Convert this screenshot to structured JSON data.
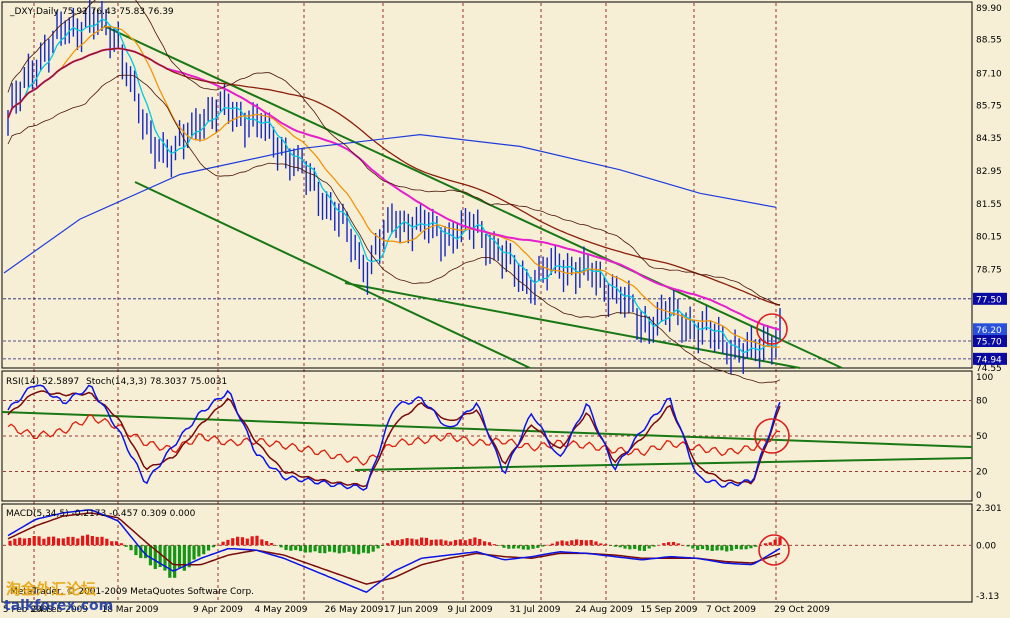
{
  "header": {
    "symbol": "_DXY,Daily",
    "ohlc": "75.92 76.43 75.83 76.39",
    "rsi_label": "RSI(14) 52.5897",
    "stoch_label": "Stoch(14,3,3) 78.3037 75.0031",
    "macd_label": "MACD(5,34,5) -0.2173 -0.457 0.309 0.000",
    "copyright": "MetaTrader, © 2001-2009 MetaQuotes Software Corp."
  },
  "watermark": {
    "chinese": "淘金外汇论坛",
    "site": "talkforex.com"
  },
  "colors": {
    "background": "#f6efd6",
    "price_bars": "#1428c8",
    "ma_fast": "#00c8e6",
    "ma_orange": "#f0960a",
    "ma_magenta": "#e61ecd",
    "ma_brown": "#8c1e0a",
    "ma_blue_long": "#1e3cdc",
    "bollinger": "#4a1406",
    "channel": "#197814",
    "rsi": "#dc1e0a",
    "stoch_main": "#0a14e6",
    "stoch_signal": "#7a0a0a",
    "macd_pos": "#e61414",
    "macd_neg": "#149614",
    "circle": "#dc1e1e",
    "price_tag_bg": "#0a0aa0",
    "grid": "#7a0000"
  },
  "chart_data": [
    {
      "type": "candlestick",
      "title": "_DXY,Daily",
      "ylim": [
        74.55,
        89.9
      ],
      "y_ticks": [
        89.9,
        88.55,
        87.1,
        85.75,
        84.35,
        82.95,
        81.55,
        80.15,
        78.75,
        77.5,
        76.2,
        75.7,
        74.94,
        74.55
      ],
      "y_tick_labels": [
        "89.90",
        "88.55",
        "87.10",
        "85.75",
        "84.35",
        "82.95",
        "81.55",
        "80.15",
        "78.75",
        "77.50",
        "76.20",
        "75.70",
        "74.94",
        "74.55"
      ],
      "x_labels": [
        "5 Feb 2009",
        "24 Feb 2009",
        "18 Mar 2009",
        "9 Apr 2009",
        "4 May 2009",
        "26 May 2009",
        "17 Jun 2009",
        "9 Jul 2009",
        "31 Jul 2009",
        "24 Aug 2009",
        "15 Sep 2009",
        "7 Oct 2009",
        "29 Oct 2009"
      ],
      "price_tags": [
        {
          "label": "77.50",
          "value": 77.5,
          "style": "dark"
        },
        {
          "label": "76.20",
          "value": 76.2,
          "style": "highlight"
        },
        {
          "label": "75.70",
          "value": 75.7,
          "style": "dark"
        },
        {
          "label": "74.94",
          "value": 74.94,
          "style": "dark"
        }
      ],
      "horizontal_levels": [
        77.5,
        75.7,
        74.94
      ],
      "price_path_x": [
        "5 Feb",
        "10 Feb",
        "17 Feb",
        "24 Feb",
        "4 Mar",
        "10 Mar",
        "18 Mar",
        "27 Mar",
        "9 Apr",
        "20 Apr",
        "4 May",
        "12 May",
        "20 May",
        "26 May",
        "3 Jun",
        "17 Jun",
        "25 Jun",
        "9 Jul",
        "20 Jul",
        "31 Jul",
        "10 Aug",
        "24 Aug",
        "3 Sep",
        "15 Sep",
        "23 Sep",
        "7 Oct",
        "15 Oct",
        "22 Oct",
        "29 Oct"
      ],
      "price_path_y": [
        85.2,
        87.6,
        88.9,
        89.4,
        88.6,
        84.5,
        83.6,
        85.3,
        85.6,
        85.0,
        83.9,
        82.5,
        80.9,
        78.8,
        80.9,
        80.6,
        80.2,
        80.6,
        79.1,
        78.2,
        79.0,
        78.6,
        77.9,
        76.4,
        76.9,
        76.3,
        75.6,
        75.1,
        76.2
      ],
      "series": [
        {
          "name": "Stoch 14,3,3",
          "values": [
            78.3,
            75.0
          ]
        }
      ]
    },
    {
      "type": "line",
      "title": "RSI(14) 52.5897 Stoch(14,3,3) 78.3037 75.0031",
      "ylim": [
        0,
        100
      ],
      "y_ticks": [
        100,
        80,
        50,
        20,
        0
      ],
      "y_tick_labels": [
        "100",
        "80",
        "50",
        "20",
        "0"
      ],
      "rsi_path_y": [
        58,
        50,
        54,
        66,
        58,
        44,
        38,
        50,
        44,
        46,
        42,
        38,
        32,
        28,
        44,
        46,
        50,
        44,
        46,
        40,
        44,
        42,
        38,
        36,
        44,
        40,
        36,
        40,
        52.6
      ],
      "stoch_path_y": [
        72,
        95,
        78,
        92,
        55,
        10,
        42,
        70,
        88,
        35,
        15,
        12,
        8,
        6,
        75,
        82,
        55,
        78,
        18,
        70,
        30,
        78,
        22,
        55,
        82,
        15,
        8,
        12,
        78
      ],
      "signal_path_y": [
        68,
        88,
        85,
        86,
        65,
        22,
        32,
        60,
        82,
        45,
        20,
        14,
        10,
        8,
        60,
        78,
        62,
        72,
        26,
        60,
        38,
        70,
        28,
        48,
        76,
        24,
        12,
        10,
        75
      ]
    },
    {
      "type": "bar",
      "title": "MACD(5,34,5) -0.2173 -0.457 0.309 0.000",
      "ylim": [
        -3.13,
        2.301
      ],
      "y_ticks": [
        2.301,
        0.0,
        -3.13
      ],
      "y_tick_labels": [
        "2.301",
        "0.00",
        "-3.13"
      ],
      "histogram": [
        0.4,
        0.6,
        0.5,
        0.7,
        0.2,
        -1.2,
        -2.2,
        -0.6,
        0.5,
        0.6,
        -0.3,
        -0.5,
        -0.5,
        -0.6,
        0.4,
        0.5,
        0.3,
        0.5,
        -0.2,
        -0.3,
        0.3,
        0.4,
        -0.1,
        -0.4,
        0.3,
        -0.3,
        -0.4,
        -0.2,
        0.5
      ],
      "macd_path_y": [
        0.6,
        1.6,
        2.0,
        2.2,
        1.5,
        -0.6,
        -1.6,
        -0.8,
        -0.2,
        -0.3,
        -0.8,
        -1.5,
        -2.2,
        -2.9,
        -1.6,
        -0.8,
        -0.6,
        -0.4,
        -0.9,
        -0.7,
        -0.4,
        -0.5,
        -0.7,
        -0.9,
        -0.7,
        -0.8,
        -1.1,
        -1.2,
        -0.2
      ],
      "signal_path_y": [
        0.4,
        1.2,
        1.8,
        2.0,
        1.7,
        0.2,
        -1.2,
        -1.2,
        -0.6,
        -0.3,
        -0.6,
        -1.2,
        -1.8,
        -2.4,
        -2.0,
        -1.2,
        -0.8,
        -0.5,
        -0.7,
        -0.8,
        -0.5,
        -0.5,
        -0.6,
        -0.8,
        -0.8,
        -0.8,
        -1.0,
        -1.1,
        -0.5
      ]
    }
  ]
}
